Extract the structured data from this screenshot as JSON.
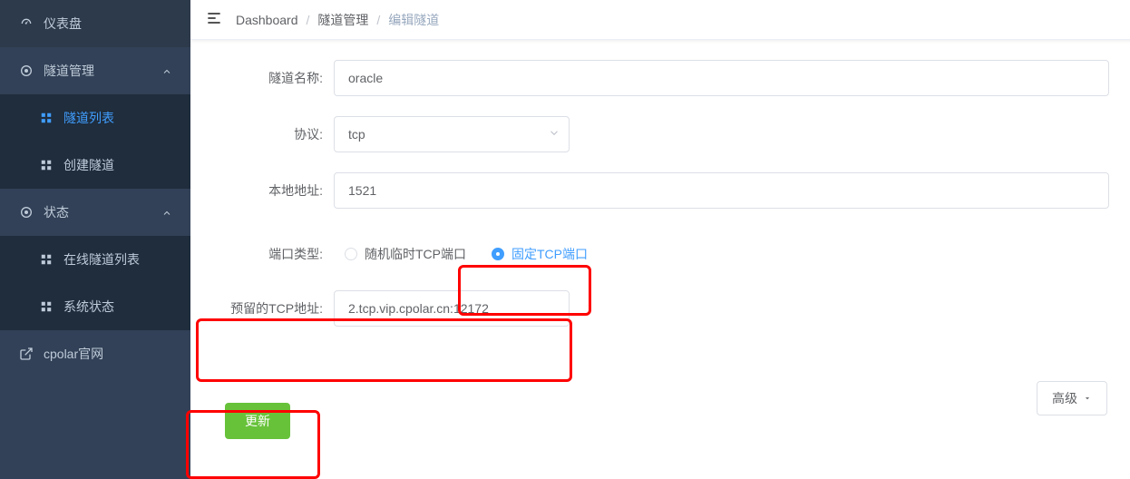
{
  "sidebar": {
    "items": [
      {
        "label": "仪表盘",
        "icon": "gauge-icon"
      },
      {
        "label": "隧道管理",
        "icon": "tunnel-icon",
        "children": [
          {
            "label": "隧道列表",
            "active": true
          },
          {
            "label": "创建隧道"
          }
        ]
      },
      {
        "label": "状态",
        "icon": "status-icon",
        "children": [
          {
            "label": "在线隧道列表"
          },
          {
            "label": "系统状态"
          }
        ]
      },
      {
        "label": "cpolar官网",
        "icon": "external-link-icon"
      }
    ]
  },
  "breadcrumb": {
    "items": [
      "Dashboard",
      "隧道管理",
      "编辑隧道"
    ]
  },
  "form": {
    "name_label": "隧道名称:",
    "name_value": "oracle",
    "protocol_label": "协议:",
    "protocol_value": "tcp",
    "local_addr_label": "本地地址:",
    "local_addr_value": "1521",
    "port_type_label": "端口类型:",
    "port_type_options": {
      "random": "随机临时TCP端口",
      "fixed": "固定TCP端口"
    },
    "port_type_selected": "fixed",
    "reserved_tcp_label": "预留的TCP地址:",
    "reserved_tcp_value": "2.tcp.vip.cpolar.cn:12172",
    "advanced_label": "高级",
    "submit_label": "更新"
  }
}
